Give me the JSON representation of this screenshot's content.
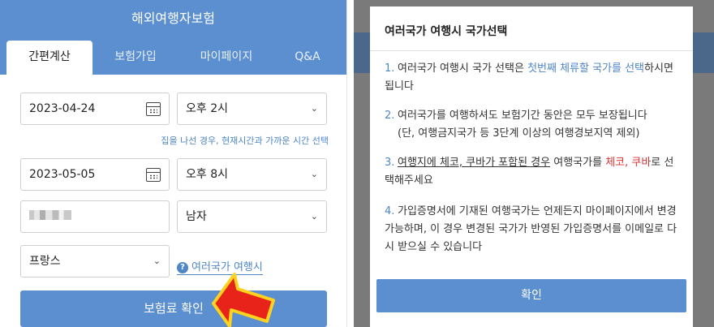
{
  "header": {
    "title": "해외여행자보험"
  },
  "tabs": [
    {
      "label": "간편계산"
    },
    {
      "label": "보험가입"
    },
    {
      "label": "마이페이지"
    },
    {
      "label": "Q&A"
    }
  ],
  "form": {
    "start_date": "2023-04-24",
    "start_time": "오후 2시",
    "time_hint": "집을 나선 경우, 현재시간과 가까운 시간 선택",
    "end_date": "2023-05-05",
    "end_time": "오후 8시",
    "gender": "남자",
    "country": "프랑스",
    "multi_country_link": "여러국가 여행시",
    "submit_label": "보험료 확인"
  },
  "modal": {
    "title": "여러국가 여행시 국가선택",
    "items": [
      {
        "num": "1.",
        "p1": "여러국가 여행시 국가 선택은 ",
        "hl": "첫번째 체류할 국가를 선택",
        "p2": "하시면 됩니다"
      },
      {
        "num": "2.",
        "line1": "여러국가를 여행하셔도 보험기간 동안은 모두 보장됩니다",
        "line2": "(단, 여행금지국가 등 3단계 이상의 여행경보지역 제외)"
      },
      {
        "num": "3.",
        "ul": "여행지에 체코, 쿠바가 포함된 경우",
        "p1": " 여행국가를 ",
        "red": "체코, 쿠바",
        "p2": "로 선택해주세요"
      },
      {
        "num": "4.",
        "text": "가입증명서에 기재된 여행국가는 언제든지 마이페이지에서 변경 가능하며, 이 경우 변경된 국가가 반영된 가입증명서를 이메일로 다시 받으실 수 있습니다"
      }
    ],
    "confirm_label": "확인"
  },
  "colors": {
    "primary": "#5b8fcf",
    "link": "#4f86c6",
    "warning_red": "#dd3333",
    "arrow_red": "#e8231a",
    "arrow_yellow": "#ffd21f"
  },
  "icons": {
    "calendar": "calendar-icon",
    "dropdown": "chevron-down-icon",
    "help": "question-circle-icon",
    "pointer": "red-arrow-icon"
  }
}
